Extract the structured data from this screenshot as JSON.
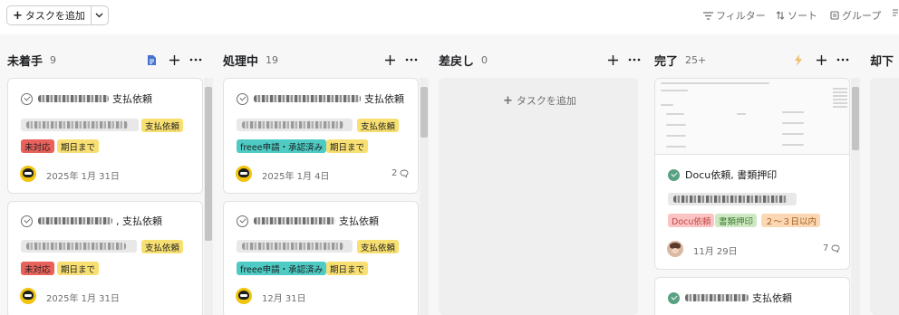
{
  "toolbar": {
    "add_task": "タスクを追加",
    "filter": "フィルター",
    "sort": "ソート",
    "group": "グループ"
  },
  "columns": [
    {
      "title": "未着手",
      "count": "9",
      "cards": [
        {
          "suffix": "支払依頼",
          "tags": [
            "支払依頼",
            "未対応",
            "期日まで"
          ],
          "date": "2025年 1月 31日"
        },
        {
          "suffix": ", 支払依頼",
          "tags": [
            "支払依頼",
            "未対応",
            "期日まで"
          ],
          "date": "2025年 1月 31日"
        }
      ]
    },
    {
      "title": "処理中",
      "count": "19",
      "cards": [
        {
          "suffix": "支払依頼",
          "tags": [
            "支払依頼",
            "freee申請・承認済み",
            "期日まで"
          ],
          "date": "2025年 1月 4日",
          "comments": "2"
        },
        {
          "suffix": "支払依頼",
          "tags": [
            "支払依頼",
            "freee申請・承認済み",
            "期日まで"
          ],
          "date": "12月 31日"
        }
      ]
    },
    {
      "title": "差戻し",
      "count": "0",
      "add_task": "タスクを追加"
    },
    {
      "title": "完了",
      "count": "25+",
      "cards": [
        {
          "title": "Docu依頼, 書類押印",
          "tags": [
            "Docu依頼",
            "書類押印",
            "２～３日以内"
          ],
          "date": "11月 29日",
          "comments": "7"
        },
        {
          "suffix": "支払依頼"
        }
      ]
    },
    {
      "title": "却下"
    }
  ],
  "colors": {
    "yellow": "#f8df72",
    "red": "#e8615a",
    "teal": "#4ecbc4",
    "done_green": "#58a182",
    "lightning": "#f1bd6c"
  }
}
